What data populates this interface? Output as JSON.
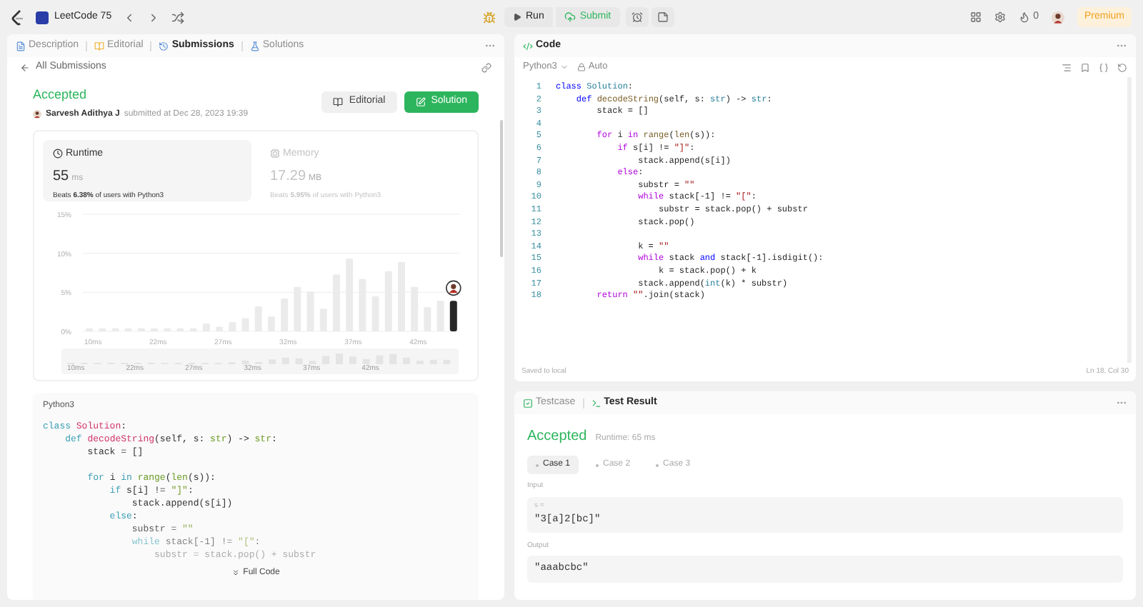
{
  "top_bar": {
    "title": "LeetCode 75",
    "run": "Run",
    "submit": "Submit",
    "streak": "0",
    "premium": "Premium"
  },
  "left_panel": {
    "tabs": [
      {
        "label": "Description",
        "selected": false
      },
      {
        "label": "Editorial",
        "selected": false
      },
      {
        "label": "Submissions",
        "selected": true
      },
      {
        "label": "Solutions",
        "selected": false
      }
    ],
    "back_link": "All Submissions",
    "submission": {
      "status": "Accepted",
      "user": "Sarvesh Adithya J",
      "submitted": "submitted at Dec 28, 2023 19:39"
    },
    "buttons": [
      {
        "label": "Editorial",
        "kind": "secondary"
      },
      {
        "label": "Solution",
        "kind": "primary"
      }
    ],
    "stats": [
      {
        "label": "Runtime",
        "value": "55",
        "unit": "ms",
        "beats": "Beats **6.38%** of users with Python3",
        "selected": true
      },
      {
        "label": "Memory",
        "value": "17.29",
        "unit": "MB",
        "beats": "Beats **5.95%** of users with Python3",
        "selected": false
      }
    ],
    "chart_data": {
      "type": "bar",
      "stacked": true,
      "ylim": [
        0,
        15
      ],
      "categories": [
        "10ms",
        null,
        null,
        null,
        null,
        "22ms",
        null,
        null,
        null,
        null,
        "27ms",
        null,
        null,
        null,
        null,
        "32ms",
        null,
        null,
        null,
        null,
        "37ms",
        null,
        null,
        null,
        null,
        "42ms",
        null,
        null,
        null
      ],
      "series": [
        {
          "color": "#ebebeb",
          "values": [
            0.4,
            0.4,
            0.4,
            0.4,
            0.4,
            0.4,
            0.4,
            0.4,
            0.4,
            1.0,
            0.6,
            1.2,
            1.7,
            3.2,
            1.9,
            4.2,
            5.7,
            5.1,
            2.9,
            7.3,
            9.3,
            6.7,
            4.5,
            7.7,
            8.9,
            5.7,
            3.1,
            3.9,
            null
          ]
        },
        {
          "color": "#262626",
          "values": [
            null,
            null,
            null,
            null,
            null,
            null,
            null,
            null,
            null,
            null,
            null,
            null,
            null,
            null,
            null,
            null,
            null,
            null,
            null,
            null,
            null,
            null,
            null,
            null,
            null,
            null,
            null,
            null,
            3.9
          ]
        }
      ],
      "yticks": [
        {
          "value": 0,
          "label": "0%"
        },
        {
          "value": 5,
          "label": "5%"
        },
        {
          "value": 10,
          "label": "10%"
        },
        {
          "value": 15,
          "label": "15%"
        }
      ]
    },
    "overview_labels": [
      "10ms",
      "22ms",
      "27ms",
      "32ms",
      "37ms",
      "42ms"
    ],
    "code_preview": {
      "language": "Python3",
      "more": "Full Code",
      "lines": [
        {
          "kind": "code",
          "tokens": [
            {
              "text": "class ",
              "kind": "k"
            },
            {
              "text": "Solution",
              "kind": "t"
            },
            {
              "text": ":",
              "kind": "p"
            }
          ]
        },
        {
          "kind": "code",
          "tokens": [
            {
              "text": "    def ",
              "kind": "k"
            },
            {
              "text": "decodeString",
              "kind": "f"
            },
            {
              "text": "(self, s: ",
              "kind": "p"
            },
            {
              "text": "str",
              "kind": "b"
            },
            {
              "text": ") -> ",
              "kind": "p"
            },
            {
              "text": "str",
              "kind": "b"
            },
            {
              "text": ":",
              "kind": "p"
            }
          ]
        },
        {
          "kind": "code",
          "tokens": [
            {
              "text": "        stack = []",
              "kind": "p"
            }
          ]
        },
        {
          "kind": "blank"
        },
        {
          "kind": "code",
          "tokens": [
            {
              "text": "        for ",
              "kind": "c"
            },
            {
              "text": "i ",
              "kind": "p"
            },
            {
              "text": "in ",
              "kind": "c"
            },
            {
              "text": "range",
              "kind": "b"
            },
            {
              "text": "(",
              "kind": "p"
            },
            {
              "text": "len",
              "kind": "b"
            },
            {
              "text": "(s)):",
              "kind": "p"
            }
          ]
        },
        {
          "kind": "code",
          "tokens": [
            {
              "text": "            if ",
              "kind": "c"
            },
            {
              "text": "s[i] != ",
              "kind": "p"
            },
            {
              "text": "\"]\"",
              "kind": "s"
            },
            {
              "text": ":",
              "kind": "p"
            }
          ]
        },
        {
          "kind": "code",
          "tokens": [
            {
              "text": "                stack.append(s[i])",
              "kind": "p"
            }
          ]
        },
        {
          "kind": "code",
          "tokens": [
            {
              "text": "            else",
              "kind": "c"
            },
            {
              "text": ":",
              "kind": "p"
            }
          ]
        },
        {
          "kind": "code",
          "tokens": [
            {
              "text": "                substr = ",
              "kind": "p"
            },
            {
              "text": "\"\"",
              "kind": "s"
            }
          ]
        },
        {
          "kind": "code",
          "tokens": [
            {
              "text": "                while ",
              "kind": "c"
            },
            {
              "text": "stack[-1] != ",
              "kind": "p"
            },
            {
              "text": "\"[\"",
              "kind": "s"
            },
            {
              "text": ":",
              "kind": "p"
            }
          ]
        },
        {
          "kind": "code",
          "tokens": [
            {
              "text": "                    substr = stack.pop() + substr",
              "kind": "p"
            }
          ]
        }
      ]
    }
  },
  "editor": {
    "tab": "Code",
    "language": "Python3",
    "mode": "Auto",
    "status_left": "Saved to local",
    "status_right": "Ln 18, Col 30",
    "lines": [
      {
        "no": "1",
        "kind": "code",
        "tokens": [
          {
            "text": "class ",
            "kind": "k"
          },
          {
            "text": "Solution",
            "kind": "t"
          },
          {
            "text": ":",
            "kind": "p"
          }
        ]
      },
      {
        "no": "2",
        "kind": "code",
        "tokens": [
          {
            "text": "    def ",
            "kind": "k"
          },
          {
            "text": "decodeString",
            "kind": "f"
          },
          {
            "text": "(self, s: ",
            "kind": "p"
          },
          {
            "text": "str",
            "kind": "t"
          },
          {
            "text": ") -> ",
            "kind": "p"
          },
          {
            "text": "str",
            "kind": "t"
          },
          {
            "text": ":",
            "kind": "p"
          }
        ]
      },
      {
        "no": "3",
        "kind": "code",
        "tokens": [
          {
            "text": "        stack = []",
            "kind": "p"
          }
        ]
      },
      {
        "no": "4",
        "kind": "blank"
      },
      {
        "no": "5",
        "kind": "code",
        "tokens": [
          {
            "text": "        for ",
            "kind": "c"
          },
          {
            "text": "i ",
            "kind": "p"
          },
          {
            "text": "in ",
            "kind": "c"
          },
          {
            "text": "range",
            "kind": "f"
          },
          {
            "text": "(",
            "kind": "p"
          },
          {
            "text": "len",
            "kind": "f"
          },
          {
            "text": "(s)):",
            "kind": "p"
          }
        ]
      },
      {
        "no": "6",
        "kind": "code",
        "tokens": [
          {
            "text": "            if ",
            "kind": "c"
          },
          {
            "text": "s[i] != ",
            "kind": "p"
          },
          {
            "text": "\"]\"",
            "kind": "s"
          },
          {
            "text": ":",
            "kind": "p"
          }
        ]
      },
      {
        "no": "7",
        "kind": "code",
        "tokens": [
          {
            "text": "                stack.append(s[i])",
            "kind": "p"
          }
        ]
      },
      {
        "no": "8",
        "kind": "code",
        "tokens": [
          {
            "text": "            else",
            "kind": "c"
          },
          {
            "text": ":",
            "kind": "p"
          }
        ]
      },
      {
        "no": "9",
        "kind": "code",
        "tokens": [
          {
            "text": "                substr = ",
            "kind": "p"
          },
          {
            "text": "\"\"",
            "kind": "s"
          }
        ]
      },
      {
        "no": "10",
        "kind": "code",
        "tokens": [
          {
            "text": "                while ",
            "kind": "c"
          },
          {
            "text": "stack[-1] != ",
            "kind": "p"
          },
          {
            "text": "\"[\"",
            "kind": "s"
          },
          {
            "text": ":",
            "kind": "p"
          }
        ]
      },
      {
        "no": "11",
        "kind": "code",
        "tokens": [
          {
            "text": "                    substr = stack.pop() + substr",
            "kind": "p"
          }
        ]
      },
      {
        "no": "12",
        "kind": "code",
        "tokens": [
          {
            "text": "                stack.pop()",
            "kind": "p"
          }
        ]
      },
      {
        "no": "13",
        "kind": "blank"
      },
      {
        "no": "14",
        "kind": "code",
        "tokens": [
          {
            "text": "                k = ",
            "kind": "p"
          },
          {
            "text": "\"\"",
            "kind": "s"
          }
        ]
      },
      {
        "no": "15",
        "kind": "code",
        "tokens": [
          {
            "text": "                while ",
            "kind": "c"
          },
          {
            "text": "stack ",
            "kind": "p"
          },
          {
            "text": "and ",
            "kind": "k"
          },
          {
            "text": "stack[-1].isdigit():",
            "kind": "p"
          }
        ]
      },
      {
        "no": "16",
        "kind": "code",
        "tokens": [
          {
            "text": "                    k = stack.pop() + k",
            "kind": "p"
          }
        ]
      },
      {
        "no": "17",
        "kind": "code",
        "tokens": [
          {
            "text": "                stack.append(",
            "kind": "p"
          },
          {
            "text": "int",
            "kind": "t"
          },
          {
            "text": "(k) * substr)",
            "kind": "p"
          }
        ]
      },
      {
        "no": "18",
        "kind": "code",
        "tokens": [
          {
            "text": "        return ",
            "kind": "c"
          },
          {
            "text": "\"\"",
            "kind": "s"
          },
          {
            "text": ".join(stack)",
            "kind": "p"
          }
        ]
      }
    ]
  },
  "console": {
    "tabs": [
      {
        "label": "Testcase",
        "selected": false
      },
      {
        "label": "Test Result",
        "selected": true
      }
    ],
    "status": "Accepted",
    "runtime": "Runtime: 65 ms",
    "cases": [
      {
        "label": "Case 1",
        "selected": true
      },
      {
        "label": "Case 2",
        "selected": false
      },
      {
        "label": "Case 3",
        "selected": false
      }
    ],
    "input_label": "Input",
    "inputs": [
      {
        "name": "s =",
        "value": "\"3[a]2[bc]\""
      }
    ],
    "output_label": "Output",
    "output": "\"aaabcbc\""
  }
}
